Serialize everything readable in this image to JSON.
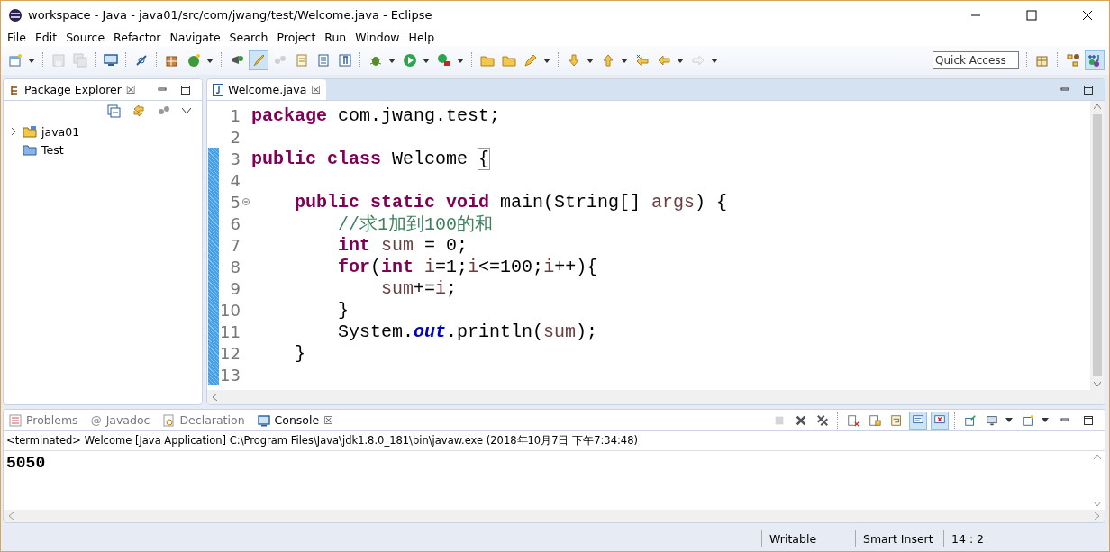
{
  "window": {
    "title": "workspace - Java - java01/src/com/jwang/test/Welcome.java - Eclipse"
  },
  "menu": [
    "File",
    "Edit",
    "Source",
    "Refactor",
    "Navigate",
    "Search",
    "Project",
    "Run",
    "Window",
    "Help"
  ],
  "toolbar": [
    {
      "kind": "new-file",
      "selected": false,
      "disabled": false
    },
    {
      "kind": "dropdown"
    },
    {
      "kind": "separator"
    },
    {
      "kind": "save",
      "selected": false,
      "disabled": true
    },
    {
      "kind": "save-all",
      "selected": false,
      "disabled": true
    },
    {
      "kind": "separator"
    },
    {
      "kind": "monitor",
      "selected": false,
      "disabled": false
    },
    {
      "kind": "separator"
    },
    {
      "kind": "pen",
      "selected": false,
      "disabled": false
    },
    {
      "kind": "separator"
    },
    {
      "kind": "package",
      "selected": false,
      "disabled": false
    },
    {
      "kind": "new-class",
      "selected": false,
      "disabled": false
    },
    {
      "kind": "dropdown"
    },
    {
      "kind": "separator"
    },
    {
      "kind": "bulb",
      "selected": false,
      "disabled": false
    },
    {
      "kind": "brush",
      "selected": true,
      "disabled": false
    },
    {
      "kind": "dots",
      "selected": false,
      "disabled": true
    },
    {
      "kind": "doc",
      "selected": false,
      "disabled": false
    },
    {
      "kind": "list",
      "selected": false,
      "disabled": false
    },
    {
      "kind": "paragraph",
      "selected": false,
      "disabled": false
    },
    {
      "kind": "separator"
    },
    {
      "kind": "bug",
      "selected": false,
      "disabled": false
    },
    {
      "kind": "dropdown"
    },
    {
      "kind": "run",
      "selected": false,
      "disabled": false
    },
    {
      "kind": "dropdown"
    },
    {
      "kind": "external",
      "selected": false,
      "disabled": false
    },
    {
      "kind": "dropdown"
    },
    {
      "kind": "separator"
    },
    {
      "kind": "folder",
      "selected": false,
      "disabled": false
    },
    {
      "kind": "folder",
      "selected": false,
      "disabled": false
    },
    {
      "kind": "pencil",
      "selected": false,
      "disabled": false
    },
    {
      "kind": "dropdown"
    },
    {
      "kind": "separator"
    },
    {
      "kind": "arrow-down",
      "selected": false,
      "disabled": false
    },
    {
      "kind": "dropdown"
    },
    {
      "kind": "arrow-up",
      "selected": false,
      "disabled": false
    },
    {
      "kind": "dropdown"
    },
    {
      "kind": "back-star",
      "selected": false,
      "disabled": false
    },
    {
      "kind": "back",
      "selected": false,
      "disabled": false
    },
    {
      "kind": "dropdown"
    },
    {
      "kind": "forward",
      "selected": false,
      "disabled": true
    },
    {
      "kind": "dropdown"
    }
  ],
  "quick_access": {
    "placeholder": "Quick Access"
  },
  "perspectives": [
    {
      "kind": "open-perspective",
      "selected": false
    },
    {
      "kind": "debug",
      "selected": false
    },
    {
      "kind": "java",
      "selected": true
    }
  ],
  "package_explorer": {
    "tab": {
      "label": "Package Explorer",
      "close": "☒"
    },
    "tree": [
      {
        "label": "java01",
        "kind": "project",
        "expanded": false
      },
      {
        "label": "Test",
        "kind": "closed-project"
      }
    ]
  },
  "editor": {
    "tabs": [
      {
        "label": "Welcome.java",
        "close": "☒",
        "selected": true
      }
    ],
    "lines": [
      {
        "number": "1",
        "changed": false,
        "tokens": [
          {
            "t": "package",
            "kind": "keyword"
          },
          {
            "t": " com.jwang.test;",
            "kind": "plain"
          }
        ]
      },
      {
        "number": "2",
        "changed": false
      },
      {
        "number": "3",
        "changed": true,
        "tokens": [
          {
            "t": "public class",
            "kind": "keyword"
          },
          {
            "t": " Welcome ",
            "kind": "plain"
          },
          {
            "t": "{",
            "kind": "bracket-match"
          }
        ]
      },
      {
        "number": "4",
        "changed": true
      },
      {
        "number": "5",
        "changed": true,
        "folded": false,
        "tokens": [
          {
            "t": "    public static void",
            "kind": "keyword"
          },
          {
            "t": " main(String[] ",
            "kind": "plain"
          },
          {
            "t": "args",
            "kind": "variable"
          },
          {
            "t": ") {",
            "kind": "plain"
          }
        ]
      },
      {
        "number": "6",
        "changed": true,
        "tokens": [
          {
            "t": "        //求1加到100的和",
            "kind": "comment"
          }
        ]
      },
      {
        "number": "7",
        "changed": true,
        "tokens": [
          {
            "t": "        int",
            "kind": "keyword"
          },
          {
            "t": " sum",
            "kind": "variable"
          },
          {
            "t": " = 0;",
            "kind": "plain"
          }
        ]
      },
      {
        "number": "8",
        "changed": true,
        "tokens": [
          {
            "t": "        for",
            "kind": "keyword"
          },
          {
            "t": "(",
            "kind": "plain"
          },
          {
            "t": "int",
            "kind": "keyword"
          },
          {
            "t": " i",
            "kind": "variable"
          },
          {
            "t": "=1;",
            "kind": "plain"
          },
          {
            "t": "i",
            "kind": "variable"
          },
          {
            "t": "<=100;",
            "kind": "plain"
          },
          {
            "t": "i",
            "kind": "variable"
          },
          {
            "t": "++){",
            "kind": "plain"
          }
        ]
      },
      {
        "number": "9",
        "changed": true,
        "tokens": [
          {
            "t": "            sum",
            "kind": "variable"
          },
          {
            "t": "+=",
            "kind": "plain"
          },
          {
            "t": "i",
            "kind": "variable"
          },
          {
            "t": ";",
            "kind": "plain"
          }
        ]
      },
      {
        "number": "10",
        "changed": true,
        "tokens": [
          {
            "t": "        }",
            "kind": "plain"
          }
        ]
      },
      {
        "number": "11",
        "changed": true,
        "tokens": [
          {
            "t": "        System.",
            "kind": "plain"
          },
          {
            "t": "out",
            "kind": "field"
          },
          {
            "t": ".println(",
            "kind": "plain"
          },
          {
            "t": "sum",
            "kind": "variable"
          },
          {
            "t": ");",
            "kind": "plain"
          }
        ]
      },
      {
        "number": "12",
        "changed": true,
        "tokens": [
          {
            "t": "    }",
            "kind": "plain"
          }
        ]
      },
      {
        "number": "13",
        "changed": true
      }
    ]
  },
  "console": {
    "tabs": [
      {
        "label": "Problems",
        "kind": "problems",
        "selected": false
      },
      {
        "label": "Javadoc",
        "kind": "javadoc",
        "icon": "@",
        "selected": false
      },
      {
        "label": "Declaration",
        "kind": "declaration",
        "selected": false
      },
      {
        "label": "Console",
        "kind": "console",
        "selected": true,
        "close": "☒"
      }
    ],
    "toolbar": [
      {
        "kind": "terminate",
        "selected": false,
        "disabled": true
      },
      {
        "kind": "remove",
        "selected": false,
        "disabled": false
      },
      {
        "kind": "remove-all",
        "selected": false,
        "disabled": false
      },
      {
        "kind": "separator"
      },
      {
        "kind": "clear",
        "selected": false,
        "disabled": false
      },
      {
        "kind": "scroll-lock",
        "selected": false,
        "disabled": false
      },
      {
        "kind": "word-wrap",
        "selected": false,
        "disabled": false
      },
      {
        "kind": "show-out",
        "selected": true,
        "disabled": false
      },
      {
        "kind": "show-err",
        "selected": true,
        "disabled": false
      },
      {
        "kind": "separator"
      },
      {
        "kind": "pin",
        "selected": false,
        "disabled": false
      },
      {
        "kind": "display",
        "selected": false,
        "disabled": false
      },
      {
        "kind": "dropdown"
      },
      {
        "kind": "open-console",
        "selected": false,
        "disabled": false
      },
      {
        "kind": "dropdown"
      }
    ],
    "status": "<terminated> Welcome [Java Application] C:\\Program Files\\Java\\jdk1.8.0_181\\bin\\javaw.exe (2018年10月7日 下午7:34:48)",
    "output": "5050"
  },
  "status_bar": [
    "Writable",
    "Smart Insert",
    "14 : 2"
  ]
}
